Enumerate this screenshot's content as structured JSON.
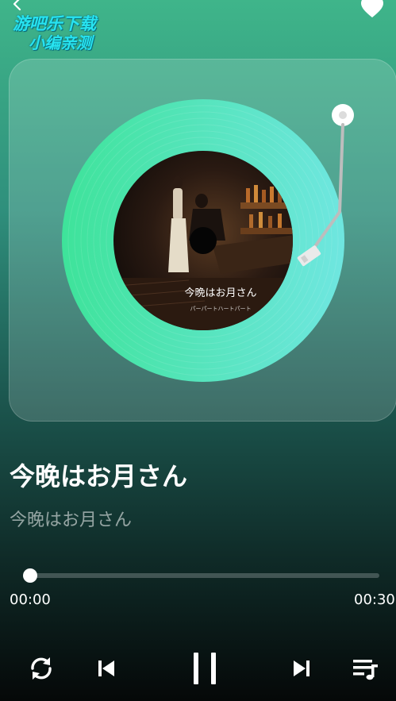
{
  "watermark": {
    "line1": "游吧乐下载",
    "line2": "小编亲测"
  },
  "song": {
    "title": "今晚はお月さん",
    "artist": "今晚はお月さん"
  },
  "album_art": {
    "title_text": "今晩はお月さん",
    "subtitle_text": "パーパートハートパート"
  },
  "player": {
    "current_time": "00:00",
    "total_time": "00:30",
    "progress": 0.0
  },
  "icons": {
    "back": "chevron-left-icon",
    "favorite": "heart-icon",
    "repeat": "repeat-icon",
    "previous": "skip-previous-icon",
    "play_pause": "pause-icon",
    "next": "skip-next-icon",
    "playlist": "playlist-icon"
  },
  "colors": {
    "vinyl_start": "#3ee39a",
    "vinyl_end": "#6fe6e0",
    "watermark": "#27e3f0",
    "accent": "#ffffff"
  }
}
